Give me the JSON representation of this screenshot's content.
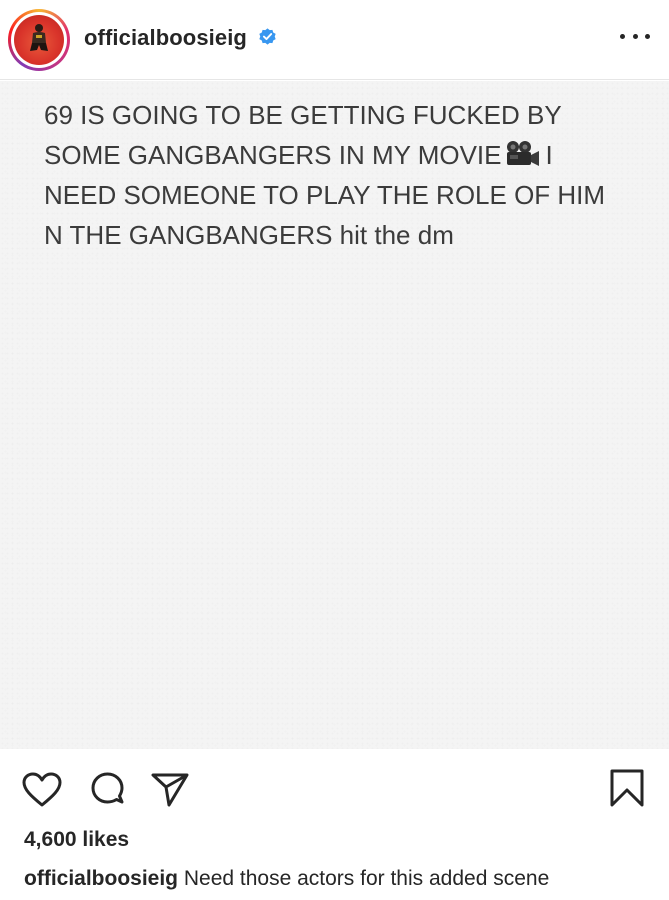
{
  "header": {
    "username": "officialboosieig",
    "verified_icon": "verified-badge-icon",
    "more_icon": "more-options-icon"
  },
  "post": {
    "text_line1": "69 IS GOING TO BE GETTING FUCKED BY",
    "text_line2a": "SOME GANGBANGERS IN MY MOVIE",
    "text_line2b": "I",
    "text_line3": "NEED SOMEONE TO PLAY THE ROLE OF HIM",
    "text_line4": "N THE GANGBANGERS hit the dm",
    "emoji_icon": "movie-camera-icon",
    "background_color": "#f4f4f4"
  },
  "actions": {
    "like_icon": "heart-icon",
    "comment_icon": "comment-icon",
    "share_icon": "share-icon",
    "save_icon": "bookmark-icon"
  },
  "likes": "4,600 likes",
  "caption": {
    "username": "officialboosieig",
    "text": "Need those actors for this added scene"
  }
}
